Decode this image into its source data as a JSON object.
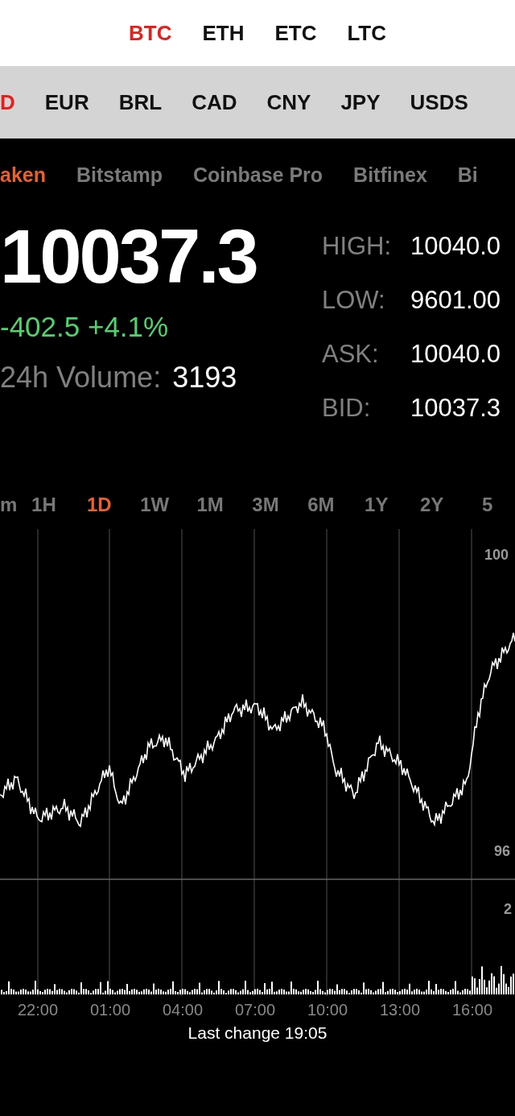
{
  "coins": [
    {
      "label": "BTC",
      "selected": true
    },
    {
      "label": "ETH",
      "selected": false
    },
    {
      "label": "ETC",
      "selected": false
    },
    {
      "label": "LTC",
      "selected": false
    }
  ],
  "currencies": [
    {
      "label": "D",
      "selected": true
    },
    {
      "label": "EUR",
      "selected": false
    },
    {
      "label": "BRL",
      "selected": false
    },
    {
      "label": "CAD",
      "selected": false
    },
    {
      "label": "CNY",
      "selected": false
    },
    {
      "label": "JPY",
      "selected": false
    },
    {
      "label": "USDS",
      "selected": false
    }
  ],
  "exchanges": [
    {
      "label": "aken",
      "selected": true
    },
    {
      "label": "Bitstamp",
      "selected": false
    },
    {
      "label": "Coinbase Pro",
      "selected": false
    },
    {
      "label": "Bitfinex",
      "selected": false
    },
    {
      "label": "Bi",
      "selected": false
    }
  ],
  "price": "10037.3",
  "change": "-402.5 +4.1%",
  "volume": {
    "label": "24h Volume:",
    "value": "3193"
  },
  "stats": [
    {
      "label": "HIGH:",
      "value": "10040.0"
    },
    {
      "label": "LOW:",
      "value": "9601.00"
    },
    {
      "label": "ASK:",
      "value": "10040.0"
    },
    {
      "label": "BID:",
      "value": "10037.3"
    }
  ],
  "ranges": [
    {
      "label": "m",
      "selected": false
    },
    {
      "label": "1H",
      "selected": false
    },
    {
      "label": "1D",
      "selected": true
    },
    {
      "label": "1W",
      "selected": false
    },
    {
      "label": "1M",
      "selected": false
    },
    {
      "label": "3M",
      "selected": false
    },
    {
      "label": "6M",
      "selected": false
    },
    {
      "label": "1Y",
      "selected": false
    },
    {
      "label": "2Y",
      "selected": false
    },
    {
      "label": "5",
      "selected": false
    }
  ],
  "chart": {
    "y_labels": [
      "100",
      "96",
      "2"
    ],
    "x_labels": [
      "22:00",
      "01:00",
      "04:00",
      "07:00",
      "10:00",
      "13:00",
      "16:00"
    ]
  },
  "last_change": "Last change 19:05"
}
